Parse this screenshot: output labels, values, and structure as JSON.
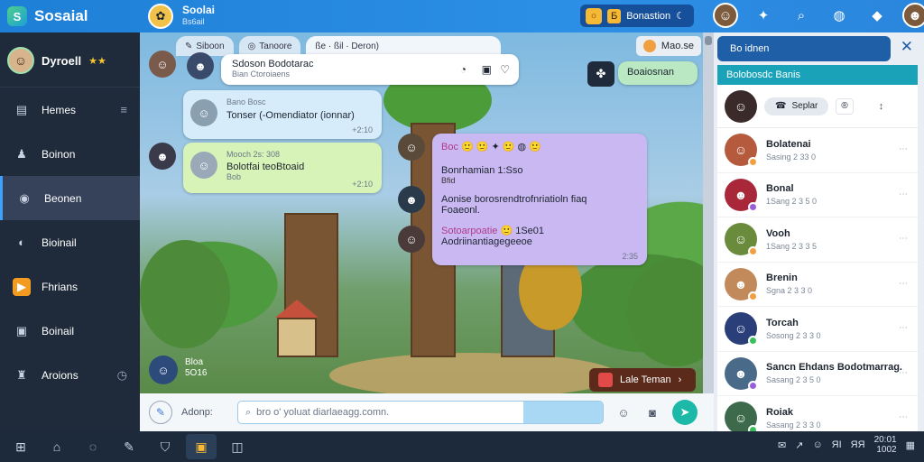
{
  "app": {
    "name": "Sosaial",
    "brand_title": "Soolai",
    "brand_subtitle": "Bs6ail",
    "pill_label": "Bonastion",
    "pill_tag": "Ƃ"
  },
  "sidebar": {
    "profile_name": "Dyroell",
    "profile_stars": "★★",
    "items": [
      {
        "label": "Hemes",
        "icon": "home-icon",
        "glyph": "▤"
      },
      {
        "label": "Boinon",
        "icon": "users-icon",
        "glyph": "♟"
      },
      {
        "label": "Beonen",
        "icon": "sound-icon",
        "glyph": "◉"
      },
      {
        "label": "Bioinail",
        "icon": "chat-icon",
        "glyph": "◐"
      },
      {
        "label": "Fhrians",
        "icon": "folder-icon",
        "glyph": "▶"
      },
      {
        "label": "Boinail",
        "icon": "note-icon",
        "glyph": "▣"
      },
      {
        "label": "Aroions",
        "icon": "bell-icon",
        "glyph": "♜"
      }
    ]
  },
  "chat": {
    "tabs": [
      "Siboon",
      "Tanoore"
    ],
    "active_tab": "ße  ·  ßil   ·   Deron)",
    "top_chip": "Mao.se",
    "top_message": {
      "title": "Sdoson Bodotarac",
      "sub": "Bian Ctoroiaens"
    },
    "side_message": "Boaiosnan",
    "msg1": {
      "title": "Bano Bosc",
      "text": "Tonser (-Omendiator (ionnar)",
      "time": "+2:10"
    },
    "msg2": {
      "title": "Mooch 2s: 308",
      "text": "Bolotfai teoBtoaid",
      "sub": "Bob",
      "time": "+2:10"
    },
    "purple": {
      "header": "Boc",
      "line1": "Bonrhamian 1:Sso",
      "line1_sub": "Bfid",
      "line2": "Aonise borosrendtrofnriatioln fiaq",
      "line3": "Foaeonl.",
      "line4": "Sotoarpoatie",
      "line4_tail": "1Se01",
      "line5": "Aodriinantiagegeeoe",
      "time": "2:35"
    },
    "bottom_user": "Bloa",
    "bottom_user_sub": "5O16",
    "quick_chip": "Lale Teman"
  },
  "composer": {
    "label": "Adonp:",
    "placeholder": "bro o' yoluat diarlaeagg.comn."
  },
  "right_panel": {
    "header": "Bo idnen",
    "subheader": "Bolobosdc Banis",
    "me_button": "Seplar",
    "me_chip": "®",
    "contacts": [
      {
        "name": "Bolatenai",
        "time": "Sasing 2 33 0",
        "color": "#b55a3c",
        "dot": "#f0a040"
      },
      {
        "name": "Bonal",
        "time": "1Sang 2 3 5 0",
        "color": "#a8283a",
        "dot": "#9a5fd8"
      },
      {
        "name": "Vooh",
        "time": "1Sang 2 3 3 5",
        "color": "#6a8a3c",
        "dot": "#f0a040"
      },
      {
        "name": "Brenin",
        "time": "Sgna 2 3 3 0",
        "color": "#c28a5a",
        "dot": "#f0a040"
      },
      {
        "name": "Torcah",
        "time": "Sosong 2 3 3 0",
        "color": "#2a3e7a",
        "dot": "#3bbf5a"
      },
      {
        "name": "Sancn Ehdans Bodotmarrag.",
        "time": "Sasang 2 3 5 0",
        "color": "#4a6a8a",
        "dot": "#9a5fd8"
      },
      {
        "name": "Roiak",
        "time": "Sasang 2 3 3 0",
        "color": "#3c6a4a",
        "dot": "#3bbf5a"
      }
    ]
  },
  "taskbar": {
    "time": "20:01",
    "date": "1002",
    "tray_text": "ЯΙ",
    "tray_text2": "ЯЯ"
  },
  "colors": {
    "topbar": "#1e7fd6",
    "sidebar": "#1f2a3a",
    "accent": "#3ea0ff",
    "send": "#1cb9a8"
  }
}
